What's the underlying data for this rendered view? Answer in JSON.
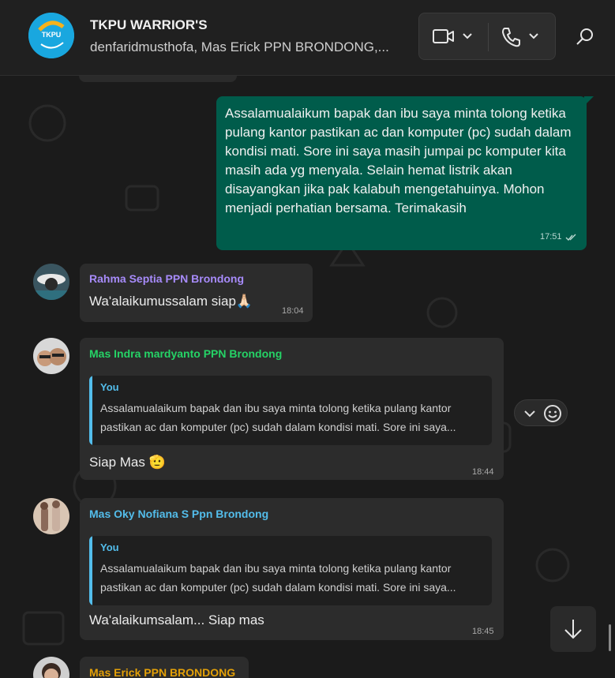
{
  "header": {
    "group_name": "TKPU WARRIOR'S",
    "members": "denfaridmusthofa, Mas Erick PPN BRONDONG,...",
    "avatar_text": "TKPU"
  },
  "messages": {
    "m1": {
      "text": "Assalamualaikum bapak dan ibu saya minta tolong ketika pulang kantor pastikan ac dan komputer (pc) sudah dalam kondisi mati. Sore ini saya masih jumpai pc komputer kita masih ada yg menyala. Selain hemat listrik akan disayangkan jika pak kalabuh mengetahuinya. Mohon menjadi perhatian bersama. Terimakasih",
      "time": "17:51"
    },
    "m2": {
      "sender": "Rahma Septia PPN Brondong",
      "text": "Wa'alaikumussalam siap🙏🏻",
      "time": "18:04"
    },
    "m3": {
      "sender": "Mas Indra mardyanto PPN Brondong",
      "quote_who": "You",
      "quote_text": "Assalamualaikum bapak dan ibu saya minta tolong ketika pulang kantor pastikan ac dan komputer (pc) sudah dalam kondisi mati. Sore ini saya...",
      "text": "Siap Mas 🫡",
      "time": "18:44"
    },
    "m4": {
      "sender": "Mas Oky Nofiana S Ppn Brondong",
      "quote_who": "You",
      "quote_text": "Assalamualaikum bapak dan ibu saya minta tolong ketika pulang kantor pastikan ac dan komputer (pc) sudah dalam kondisi mati. Sore ini saya...",
      "text": "Wa'alaikumsalam... Siap mas",
      "time": "18:45"
    },
    "m5": {
      "sender": "Mas Erick PPN BRONDONG"
    }
  },
  "colors": {
    "outgoing_bubble": "#005c4b",
    "incoming_bubble": "#2c2c2c",
    "sender_rahma": "#a78bfa",
    "sender_indra": "#25d366",
    "sender_oky": "#53bdeb",
    "sender_erick": "#e3a008"
  },
  "icons": [
    "video-call-icon",
    "voice-call-icon",
    "search-icon",
    "chevron-down-icon",
    "emoji-icon",
    "arrow-down-icon",
    "double-check-icon"
  ]
}
